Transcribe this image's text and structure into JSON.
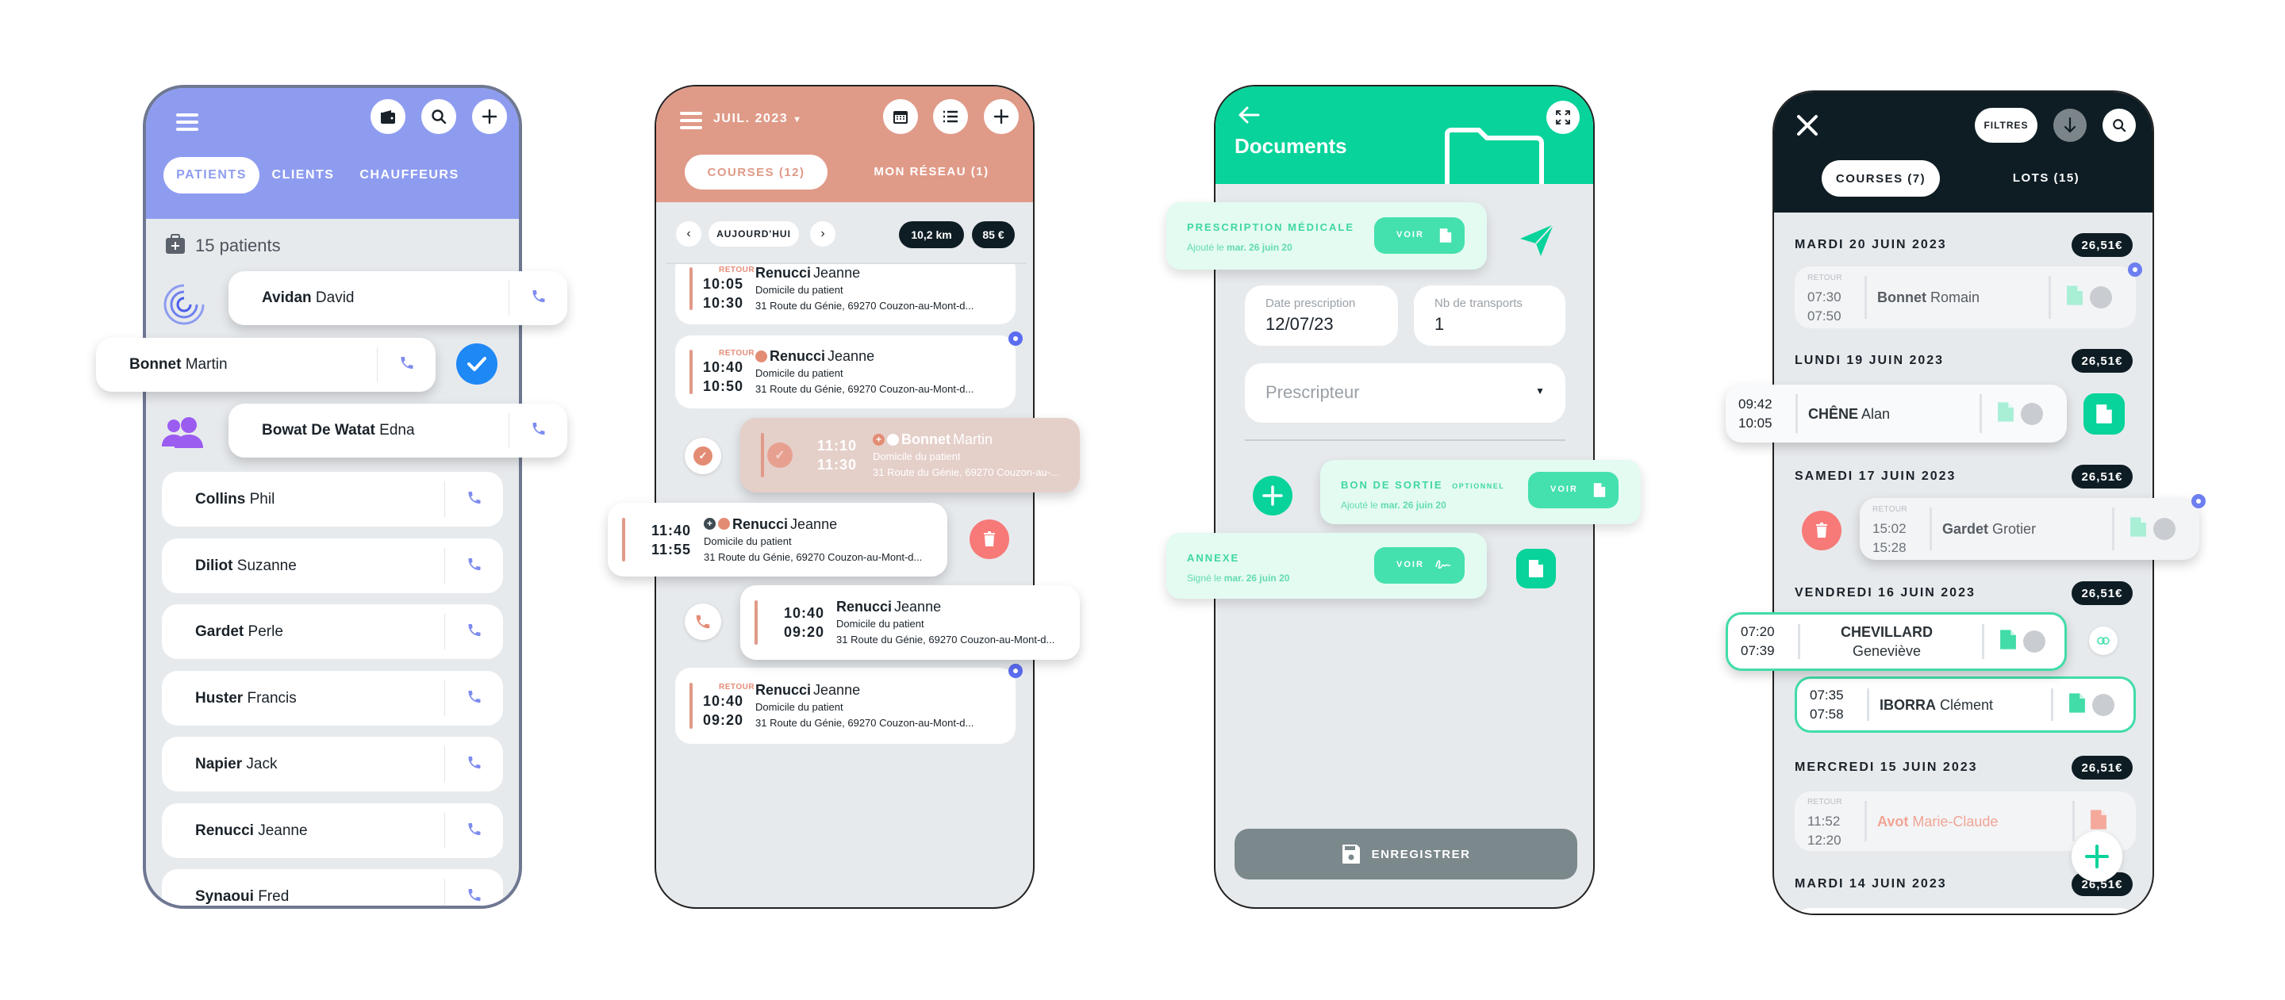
{
  "colors": {
    "patients_header": "#8e9cf0",
    "courses_header": "#e09a88",
    "documents_header": "#07d39a",
    "history_header": "#0e1d24",
    "accent_blue": "#1e88f5",
    "delete_red": "#f77a78",
    "mint": "#44e0ad"
  },
  "patients_screen": {
    "header_icons": [
      "menu-icon",
      "wallet-icon",
      "search-icon",
      "plus-icon"
    ],
    "tabs": [
      "PATIENTS",
      "CLIENTS",
      "CHAUFFEURS"
    ],
    "active_tab": "PATIENTS",
    "count_label": "15 patients",
    "patients": [
      {
        "last": "Avidan",
        "first": "David",
        "marker": "loading-icon"
      },
      {
        "last": "Bonnet",
        "first": "Martin",
        "marker": "check-icon",
        "selected": true
      },
      {
        "last": "Bowat De Watat",
        "first": "Edna",
        "marker": "group-icon"
      },
      {
        "last": "Collins",
        "first": "Phil"
      },
      {
        "last": "Diliot",
        "first": "Suzanne"
      },
      {
        "last": "Gardet",
        "first": "Perle"
      },
      {
        "last": "Huster",
        "first": "Francis"
      },
      {
        "last": "Napier",
        "first": "Jack"
      },
      {
        "last": "Renucci",
        "first": "Jeanne"
      },
      {
        "last": "Synaoui",
        "first": "Fred"
      }
    ]
  },
  "courses_screen": {
    "month": "JUIL. 2023",
    "header_icons": [
      "menu-icon",
      "calendar-icon",
      "list-icon",
      "plus-icon"
    ],
    "tabs": [
      "COURSES (12)",
      "MON RÉSEAU (1)"
    ],
    "active_tab": "COURSES (12)",
    "today_label": "AUJOURD'HUI",
    "distance": "10,2 km",
    "total": "85 €",
    "rides": [
      {
        "tag": "RETOUR",
        "start": "10:05",
        "end": "10:30",
        "last": "Renucci",
        "first": "Jeanne",
        "place": "Domicile du patient",
        "address": "31 Route du Génie, 69270 Couzon-au-Mont-d...",
        "icons": [],
        "dot": false
      },
      {
        "tag": "RETOUR",
        "start": "10:40",
        "end": "10:50",
        "last": "Renucci",
        "first": "Jeanne",
        "place": "Domicile du patient",
        "address": "31 Route du Génie, 69270 Couzon-au-Mont-d...",
        "icons": [
          "clock"
        ],
        "dot": true
      },
      {
        "tag": "",
        "start": "11:10",
        "end": "11:30",
        "last": "Bonnet",
        "first": "Martin",
        "place": "Domicile du patient",
        "address": "31 Route du Génie, 69270 Couzon-au-...",
        "icons": [
          "plus",
          "clock"
        ],
        "dot": false,
        "done": true,
        "swipe_action": "check"
      },
      {
        "tag": "",
        "start": "11:40",
        "end": "11:55",
        "last": "Renucci",
        "first": "Jeanne",
        "place": "Domicile du patient",
        "address": "31 Route du Génie, 69270 Couzon-au-Mont-d...",
        "icons": [
          "plus",
          "clock"
        ],
        "dot": false,
        "swipe_action": "delete"
      },
      {
        "tag": "",
        "start": "10:40",
        "end": "09:20",
        "last": "Renucci",
        "first": "Jeanne",
        "place": "Domicile du patient",
        "address": "31 Route du Génie, 69270 Couzon-au-Mont-d...",
        "icons": [],
        "dot": false,
        "swipe_action": "call"
      },
      {
        "tag": "RETOUR",
        "start": "10:40",
        "end": "09:20",
        "last": "Renucci",
        "first": "Jeanne",
        "place": "Domicile du patient",
        "address": "31 Route du Génie, 69270 Couzon-au-Mont-d...",
        "icons": [],
        "dot": true
      }
    ]
  },
  "documents_screen": {
    "title": "Documents",
    "documents": [
      {
        "title": "PRESCRIPTION MÉDICALE",
        "optional": "",
        "status_prefix": "Ajouté le",
        "date": "mar. 26 juin 20",
        "button": "VOIR",
        "button_icon": "file-icon"
      },
      {
        "title": "BON DE SORTIE",
        "optional": "OPTIONNEL",
        "status_prefix": "Ajouté le",
        "date": "mar. 26 juin 20",
        "button": "VOIR",
        "button_icon": "file-icon"
      },
      {
        "title": "ANNEXE",
        "optional": "",
        "status_prefix": "Signé le",
        "date": "mar. 26 juin 20",
        "button": "VOIR",
        "button_icon": "signature-icon"
      }
    ],
    "date_field": {
      "label": "Date prescription",
      "value": "12/07/23"
    },
    "count_field": {
      "label": "Nb de transports",
      "value": "1"
    },
    "prescriber_select": {
      "placeholder": "Prescripteur"
    },
    "save_label": "ENREGISTRER"
  },
  "history_screen": {
    "filters_label": "FILTRES",
    "tabs": [
      "COURSES (7)",
      "LOTS (15)"
    ],
    "active_tab": "COURSES (7)",
    "days": [
      {
        "label": "MARDI 20 JUIN 2023",
        "price": "26,51€",
        "rides": [
          {
            "tag": "RETOUR",
            "start": "07:30",
            "end": "07:50",
            "last": "Bonnet",
            "first": "Romain",
            "state": "faded",
            "dot": true
          }
        ]
      },
      {
        "label": "LUNDI 19 JUIN 2023",
        "price": "26,51€",
        "rides": [
          {
            "tag": "",
            "start": "09:42",
            "end": "10:05",
            "last": "CHÊNE",
            "first": "Alan",
            "state": "swiped",
            "swipe_action": "document"
          }
        ]
      },
      {
        "label": "SAMEDI 17 JUIN 2023",
        "price": "26,51€",
        "rides": [
          {
            "tag": "RETOUR",
            "start": "15:02",
            "end": "15:28",
            "last": "Gardet",
            "first": "Grotier",
            "state": "faded",
            "dot": true,
            "swipe_action": "delete"
          }
        ]
      },
      {
        "label": "VENDREDI 16 JUIN 2023",
        "price": "26,51€",
        "rides": [
          {
            "tag": "",
            "start": "07:20",
            "end": "07:39",
            "last": "CHEVILLARD",
            "first": "Geneviève",
            "state": "linked",
            "swipe_action": "link"
          },
          {
            "tag": "",
            "start": "07:35",
            "end": "07:58",
            "last": "IBORRA",
            "first": "Clément",
            "state": "linked"
          }
        ]
      },
      {
        "label": "MERCREDI 15 JUIN 2023",
        "price": "26,51€",
        "rides": [
          {
            "tag": "RETOUR",
            "start": "11:52",
            "end": "12:20",
            "last": "Avot",
            "first": "Marie-Claude",
            "state": "cancelled"
          }
        ]
      },
      {
        "label": "MARDI 14 JUIN 2023",
        "price": "26,51€",
        "rides": []
      }
    ]
  }
}
